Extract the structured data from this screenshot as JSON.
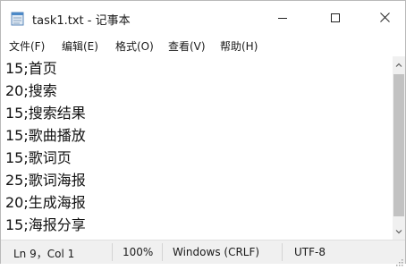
{
  "window": {
    "title": "task1.txt - 记事本",
    "icons": {
      "app": "notepad-icon",
      "minimize": "minimize-icon",
      "maximize": "maximize-icon",
      "close": "close-icon"
    }
  },
  "menubar": {
    "items": [
      "文件(F)",
      "编辑(E)",
      "格式(O)",
      "查看(V)",
      "帮助(H)"
    ]
  },
  "editor": {
    "lines": [
      "15;首页",
      "20;搜索",
      "15;搜索结果",
      "15;歌曲播放",
      "15;歌词页",
      "25;歌词海报",
      "20;生成海报",
      "15;海报分享"
    ]
  },
  "statusbar": {
    "position": "Ln 9，Col 1",
    "zoom": "100%",
    "line_ending": "Windows (CRLF)",
    "encoding": "UTF-8"
  }
}
